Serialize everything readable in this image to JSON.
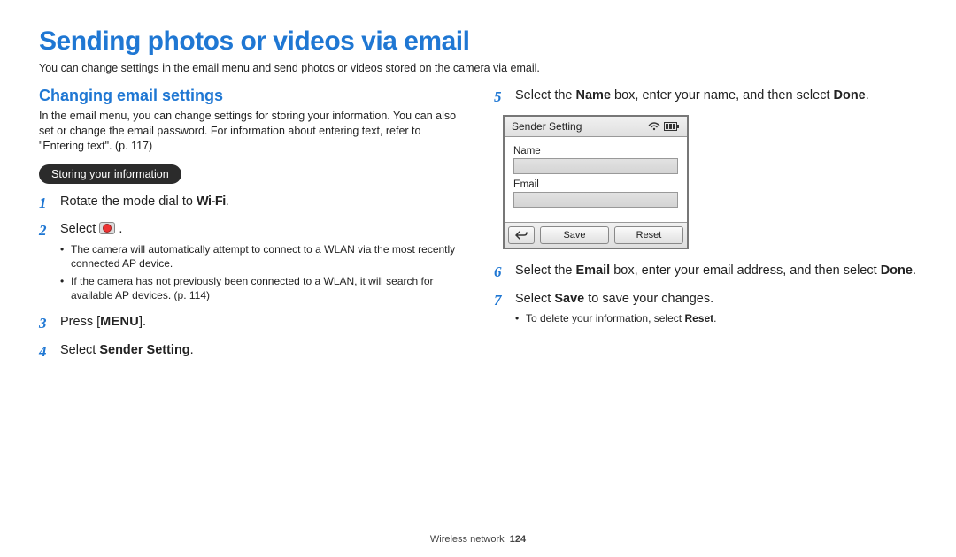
{
  "heading": "Sending photos or videos via email",
  "intro": "You can change settings in the email menu and send photos or videos stored on the camera via email.",
  "subheading": "Changing email settings",
  "subpara": "In the email menu, you can change settings for storing your information. You can also set or change the email password. For information about entering text, refer to \"Entering text\". (p. 117)",
  "pill": "Storing your information",
  "left_steps": {
    "s1": {
      "num": "1",
      "pre": "Rotate the mode dial to ",
      "chip": "Wi-Fi",
      "post": "."
    },
    "s2": {
      "num": "2",
      "pre": "Select ",
      "post": ".",
      "bullets": [
        "The camera will automatically attempt to connect to a WLAN via the most recently connected AP device.",
        "If the camera has not previously been connected to a WLAN, it will search for available AP devices. (p. 114)"
      ]
    },
    "s3": {
      "num": "3",
      "pre": "Press [",
      "chip": "MENU",
      "post": "]."
    },
    "s4": {
      "num": "4",
      "pre": "Select ",
      "bold": "Sender Setting",
      "post": "."
    }
  },
  "right_steps": {
    "s5": {
      "num": "5",
      "pre": "Select the ",
      "bold1": "Name",
      "mid": " box, enter your name, and then select ",
      "bold2": "Done",
      "post": "."
    },
    "s6": {
      "num": "6",
      "pre": "Select the ",
      "bold1": "Email",
      "mid": " box, enter your email address, and then select ",
      "bold2": "Done",
      "post": "."
    },
    "s7": {
      "num": "7",
      "pre": "Select ",
      "bold1": "Save",
      "post": " to save your changes.",
      "bullets": [
        "To delete your information, select Reset."
      ],
      "bullet_bold": "Reset"
    }
  },
  "screen": {
    "title": "Sender Setting",
    "name_label": "Name",
    "email_label": "Email",
    "save": "Save",
    "reset": "Reset"
  },
  "footer": {
    "section": "Wireless network",
    "page": "124"
  }
}
